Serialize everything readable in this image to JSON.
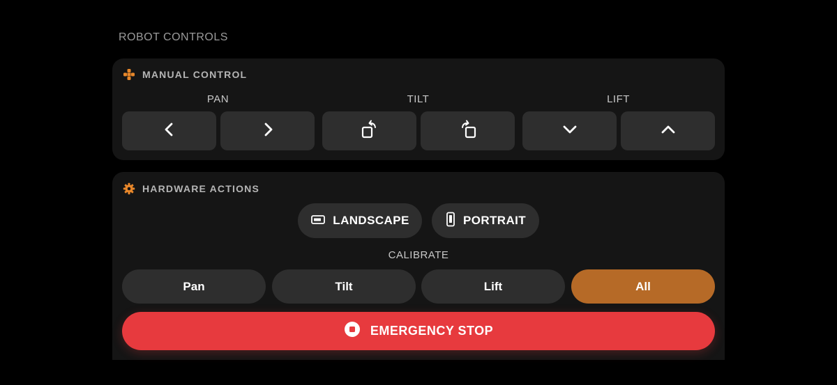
{
  "header": {
    "title": "ROBOT CONTROLS"
  },
  "manual_control": {
    "title": "MANUAL CONTROL",
    "groups": [
      {
        "label": "PAN"
      },
      {
        "label": "TILT"
      },
      {
        "label": "LIFT"
      }
    ],
    "buttons": [
      {
        "icon": "chevron-left-icon"
      },
      {
        "icon": "chevron-right-icon"
      },
      {
        "icon": "rotate-right-icon"
      },
      {
        "icon": "rotate-left-icon"
      },
      {
        "icon": "chevron-down-icon"
      },
      {
        "icon": "chevron-up-icon"
      }
    ]
  },
  "hardware_actions": {
    "title": "HARDWARE ACTIONS",
    "orientation": {
      "landscape_label": "LANDSCAPE",
      "portrait_label": "PORTRAIT"
    },
    "calibrate": {
      "label": "CALIBRATE",
      "options": [
        "Pan",
        "Tilt",
        "Lift",
        "All"
      ],
      "selected": "All"
    },
    "emergency_stop_label": "EMERGENCY STOP"
  },
  "colors": {
    "accent": "#e8872a",
    "selected": "#b66a27",
    "danger": "#e73a3e",
    "button": "#2e2e2e",
    "card": "#151515"
  }
}
